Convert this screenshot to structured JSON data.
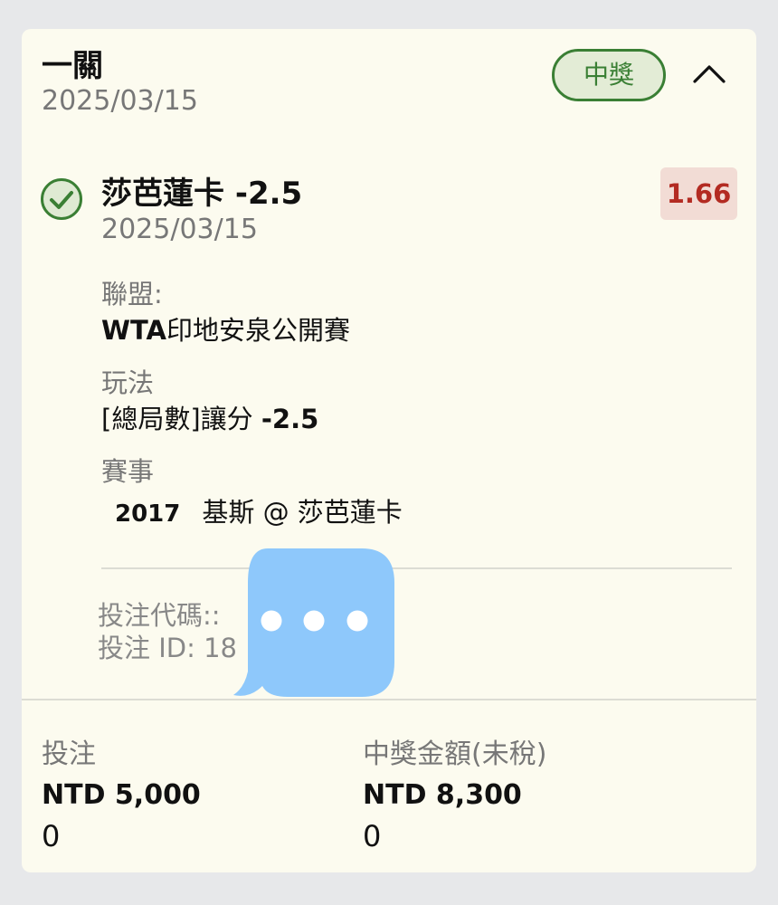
{
  "header": {
    "bet_type": "一關",
    "date": "2025/03/15",
    "status": "中獎",
    "collapse_icon": "chevron-up-icon"
  },
  "selection": {
    "name": "莎芭蓮卡",
    "handicap": "-2.5",
    "date": "2025/03/15",
    "odds": "1.66",
    "status_icon": "check-circle-icon",
    "league_label": "聯盟:",
    "league_prefix": "WTA",
    "league_name": "印地安泉公開賽",
    "market_label": "玩法",
    "market_name": "[總局數]讓分",
    "market_line": "-2.5",
    "event_label": "賽事",
    "event_code": "2017",
    "event_name": "基斯 @ 莎芭蓮卡"
  },
  "bet_info": {
    "code_label": "投注代碼::",
    "id_label": "投注 ID: 18"
  },
  "footer": {
    "stake_label": "投注",
    "stake_amount": "NTD 5,000",
    "stake_extra": "0",
    "payout_label": "中獎金額(未稅)",
    "payout_amount": "NTD 8,300",
    "payout_extra": "0"
  },
  "overlay": {
    "icon": "chat-bubble-icon",
    "color": "#8ec8fb"
  },
  "colors": {
    "win_green": "#3a7f34",
    "odds_red": "#b32b22",
    "card_bg": "#fcfbef"
  }
}
